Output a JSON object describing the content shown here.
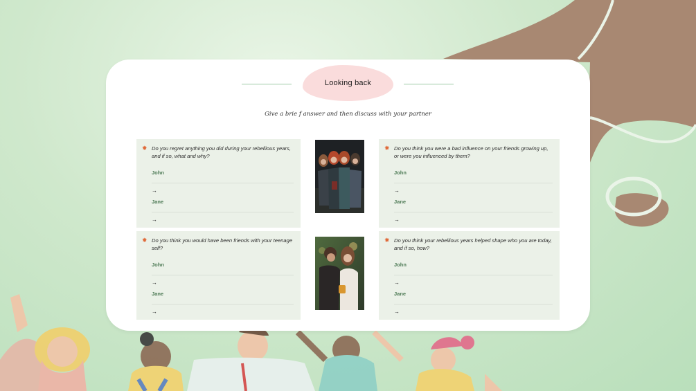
{
  "title": "Looking back",
  "subtitle": "Give a brie f answer and then discuss with your partner",
  "questions": [
    {
      "text": "Do you regret anything you did during your rebellious years, and if so, what and why?",
      "answers": [
        {
          "name": "John",
          "arrow": "→"
        },
        {
          "name": "Jane",
          "arrow": "→"
        }
      ]
    },
    {
      "text": "Do you think you were a bad influence on your friends growing up, or were you influenced by them?",
      "answers": [
        {
          "name": "John",
          "arrow": "→"
        },
        {
          "name": "Jane",
          "arrow": "→"
        }
      ]
    },
    {
      "text": "Do you think you would have been friends with your teenage self?",
      "answers": [
        {
          "name": "John",
          "arrow": "→"
        },
        {
          "name": "Jane",
          "arrow": "→"
        }
      ]
    },
    {
      "text": "Do you think your rebellious years helped shape who you are today, and if so, how?",
      "answers": [
        {
          "name": "John",
          "arrow": "→"
        },
        {
          "name": "Jane",
          "arrow": "→"
        }
      ]
    }
  ],
  "icons": {
    "question": "sparkle-burst-icon",
    "answer_arrow": "arrow-right-icon"
  },
  "colors": {
    "background": "#c4e4c2",
    "card": "#ffffff",
    "title_pill": "#fadcdc",
    "question_box": "#ebf1e8",
    "name_text": "#4d7a55",
    "blob_brown": "#a88872",
    "accent_line": "#9cc9a4"
  }
}
